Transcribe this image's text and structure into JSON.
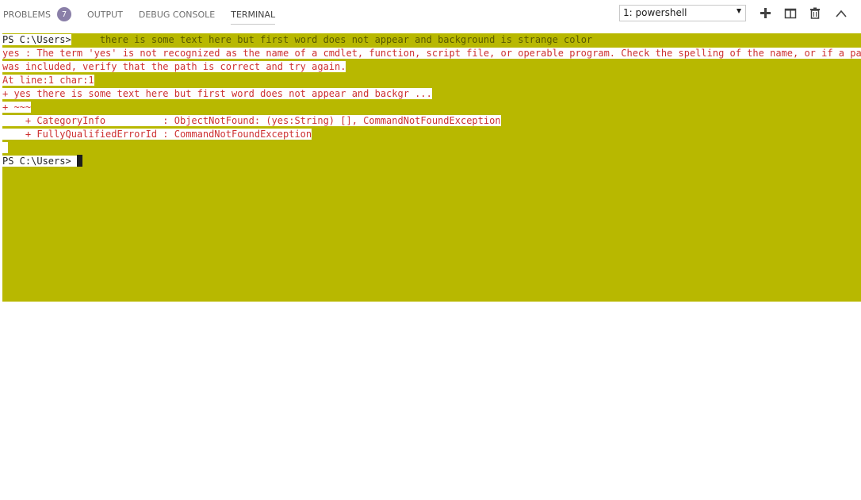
{
  "tabs": [
    {
      "label": "PROBLEMS",
      "badge": "7"
    },
    {
      "label": "OUTPUT"
    },
    {
      "label": "DEBUG CONSOLE"
    },
    {
      "label": "TERMINAL"
    }
  ],
  "terminal_select": {
    "value": "1: powershell"
  },
  "icons": {
    "new": "plus-icon",
    "split": "split-terminal-icon",
    "kill": "trash-icon",
    "maximize": "chevron-up-icon"
  },
  "colors": {
    "terminal_bg": "#b8b800",
    "error_text": "#cd3131",
    "badge_bg": "#8a7fa8"
  },
  "terminal": {
    "prompt1": "PS C:\\Users>",
    "command": "     there is some text here but first word does not appear and background is strange color",
    "err1": "yes : The term 'yes' is not recognized as the name of a cmdlet, function, script file, or operable program. Check the spelling of the name, or if a path",
    "err2": "was included, verify that the path is correct and try again.",
    "err3": "At line:1 char:1",
    "err4": "+ yes there is some text here but first word does not appear and backgr ...",
    "err5": "+ ~~~",
    "err6": "    + CategoryInfo          : ObjectNotFound: (yes:String) [], CommandNotFoundException",
    "err7": "    + FullyQualifiedErrorId : CommandNotFoundException",
    "err8": " ",
    "prompt2": "PS C:\\Users> "
  }
}
